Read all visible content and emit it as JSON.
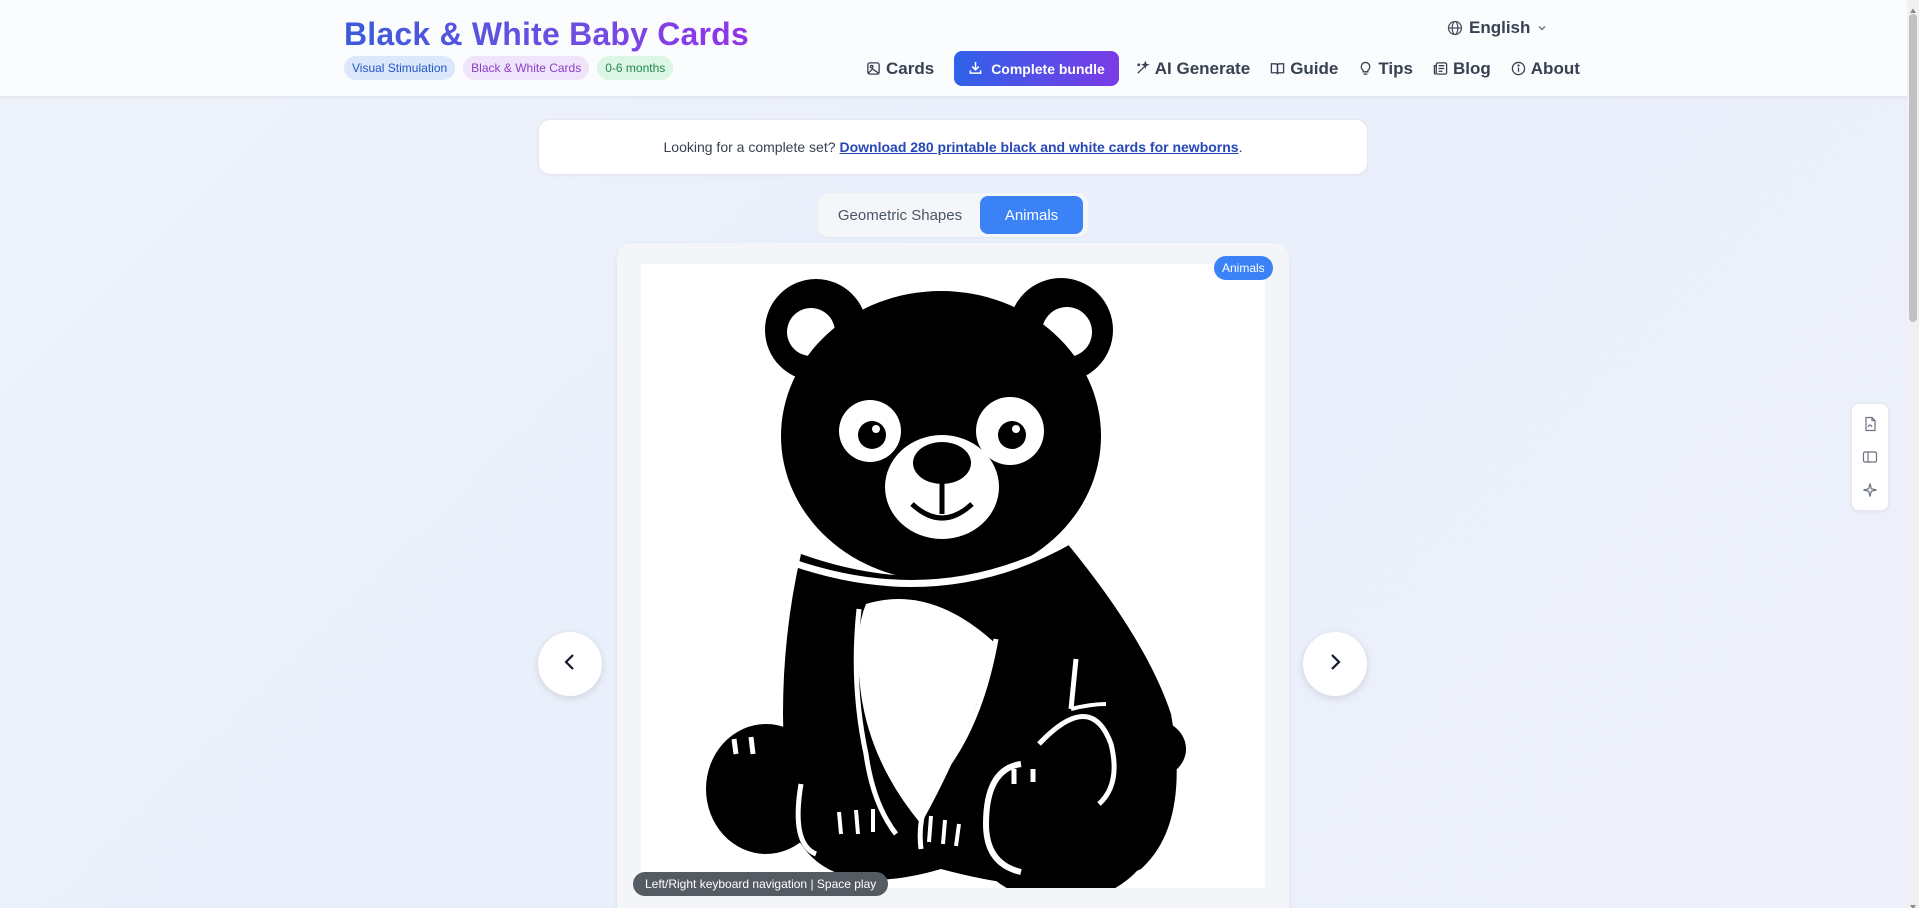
{
  "brand": {
    "title": "Black & White Baby Cards",
    "tags": [
      "Visual Stimulation",
      "Black & White Cards",
      "0-6 months"
    ]
  },
  "language": {
    "label": "English"
  },
  "nav": {
    "cards": "Cards",
    "bundle": "Complete bundle",
    "ai_generate": "AI Generate",
    "guide": "Guide",
    "tips": "Tips",
    "blog": "Blog",
    "about": "About"
  },
  "banner": {
    "text": "Looking for a complete set?",
    "link": "Download 280 printable black and white cards for newborns",
    "suffix": "."
  },
  "tabs": [
    {
      "label": "Geometric Shapes",
      "active": false
    },
    {
      "label": "Animals",
      "active": true
    }
  ],
  "card": {
    "category_badge": "Animals",
    "keyboard_hint": "Left/Right keyboard navigation | Space play",
    "image_subject": "bear-illustration"
  },
  "colors": {
    "accent": "#3b82f6",
    "brand_gradient_start": "#3b5bdb",
    "brand_gradient_end": "#9333ea"
  }
}
